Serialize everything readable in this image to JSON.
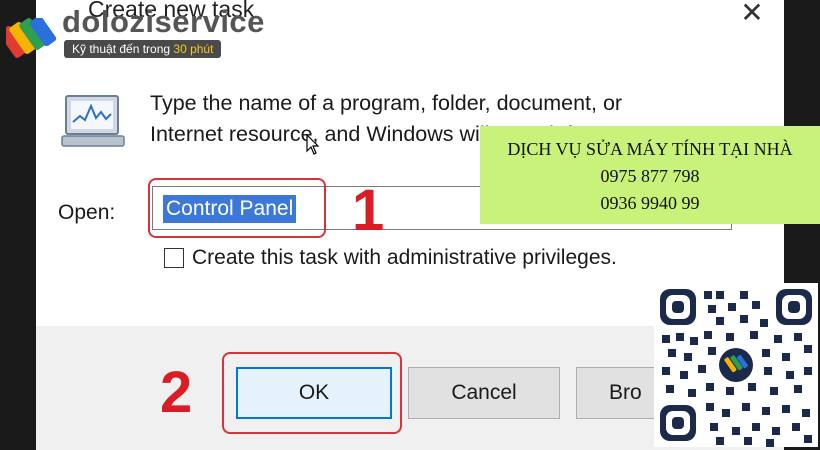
{
  "dialog": {
    "title": "Create new task",
    "close_glyph": "✕",
    "description_line1": "Type the name of a program, folder, document, or",
    "description_line2": "Internet resource, and Windows will open it for you.",
    "open_label": "Open:",
    "open_value": "Control Panel",
    "admin_checkbox_label": "Create this task with administrative privileges.",
    "admin_checked": false,
    "buttons": {
      "ok": "OK",
      "cancel": "Cancel",
      "browse": "Bro"
    },
    "icon": "run-program-icon"
  },
  "annotations": {
    "step1": "1",
    "step2": "2",
    "color": "#d91d25"
  },
  "watermark": {
    "brand": "doloziservice",
    "tagline_prefix": "Kỹ thuật đến trong ",
    "tagline_highlight": "30 phút"
  },
  "ad": {
    "line1": "DỊCH VỤ SỬA MÁY TÍNH TẠI NHÀ",
    "phone1": "0975 877 798",
    "phone2": "0936 9940 99",
    "background": "#c9f27a"
  },
  "qr": {
    "icon": "qr-code-icon"
  },
  "colors": {
    "selection": "#3b78d8",
    "focus_border": "#0078d7"
  }
}
